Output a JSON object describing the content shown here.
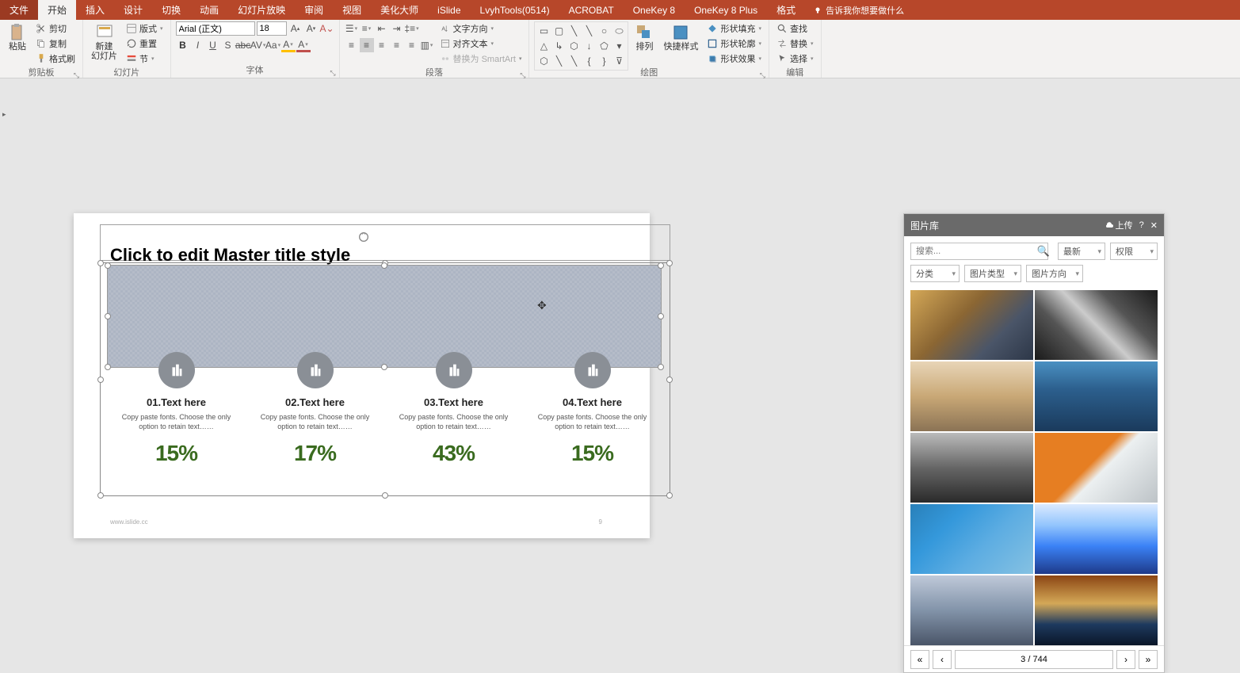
{
  "tabs": {
    "file": "文件",
    "home": "开始",
    "insert": "插入",
    "design": "设计",
    "transition": "切换",
    "animation": "动画",
    "slideshow": "幻灯片放映",
    "review": "审阅",
    "view": "视图",
    "beautify": "美化大师",
    "islide": "iSlide",
    "lvyh": "LvyhTools(0514)",
    "acrobat": "ACROBAT",
    "onekey8": "OneKey 8",
    "onekey8plus": "OneKey 8 Plus",
    "format": "格式",
    "tellme": "告诉我你想要做什么"
  },
  "ribbon": {
    "clipboard": {
      "label": "剪贴板",
      "paste": "粘贴",
      "cut": "剪切",
      "copy": "复制",
      "format_painter": "格式刷"
    },
    "slides": {
      "label": "幻灯片",
      "new_slide": "新建\n幻灯片",
      "layout": "版式",
      "reset": "重置",
      "section": "节"
    },
    "font": {
      "label": "字体",
      "font_name": "Arial (正文)",
      "font_size": "18"
    },
    "paragraph": {
      "label": "段落",
      "text_dir": "文字方向",
      "align_text": "对齐文本",
      "smartart": "替换为 SmartArt"
    },
    "drawing": {
      "label": "绘图",
      "arrange": "排列",
      "quick_styles": "快捷样式",
      "shape_fill": "形状填充",
      "shape_outline": "形状轮廓",
      "shape_effects": "形状效果"
    },
    "editing": {
      "label": "编辑",
      "find": "查找",
      "replace": "替换",
      "select": "选择"
    }
  },
  "slide": {
    "title": "Click to edit Master title style",
    "cols": [
      {
        "title": "01.Text here",
        "desc": "Copy paste fonts. Choose the only option to retain text……",
        "pct": "15%"
      },
      {
        "title": "02.Text here",
        "desc": "Copy paste fonts. Choose the only option to retain text……",
        "pct": "17%"
      },
      {
        "title": "03.Text here",
        "desc": "Copy paste fonts. Choose the only option to retain text……",
        "pct": "43%"
      },
      {
        "title": "04.Text here",
        "desc": "Copy paste fonts. Choose the only option to retain text……",
        "pct": "15%"
      }
    ],
    "footer_left": "www.islide.cc",
    "footer_right": "9"
  },
  "panel": {
    "title": "图片库",
    "upload": "上传",
    "search_placeholder": "搜索...",
    "sort": "最新",
    "license": "权限",
    "category": "分类",
    "imgtype": "图片类型",
    "orientation": "图片方向",
    "page_info": "3 / 744"
  }
}
